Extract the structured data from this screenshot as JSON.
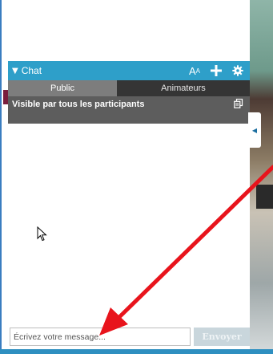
{
  "chat": {
    "title": "Chat",
    "tabs": [
      {
        "label": "Public",
        "active": true
      },
      {
        "label": "Animateurs",
        "active": false
      }
    ],
    "visibility_text": "Visible par tous les participants",
    "input": {
      "placeholder": "Écrivez votre message...",
      "value": ""
    },
    "send_label": "Envoyer",
    "font_size_icon": "text-size-icon",
    "add_icon": "plus-icon",
    "settings_icon": "gear-icon"
  },
  "colors": {
    "header": "#2e9fc9",
    "tab_active": "#7d7d7d",
    "tab_inactive": "#353535",
    "visibility_bar": "#5d5d5d",
    "send_disabled": "#c9d6dc",
    "annotation": "#e8141c"
  }
}
